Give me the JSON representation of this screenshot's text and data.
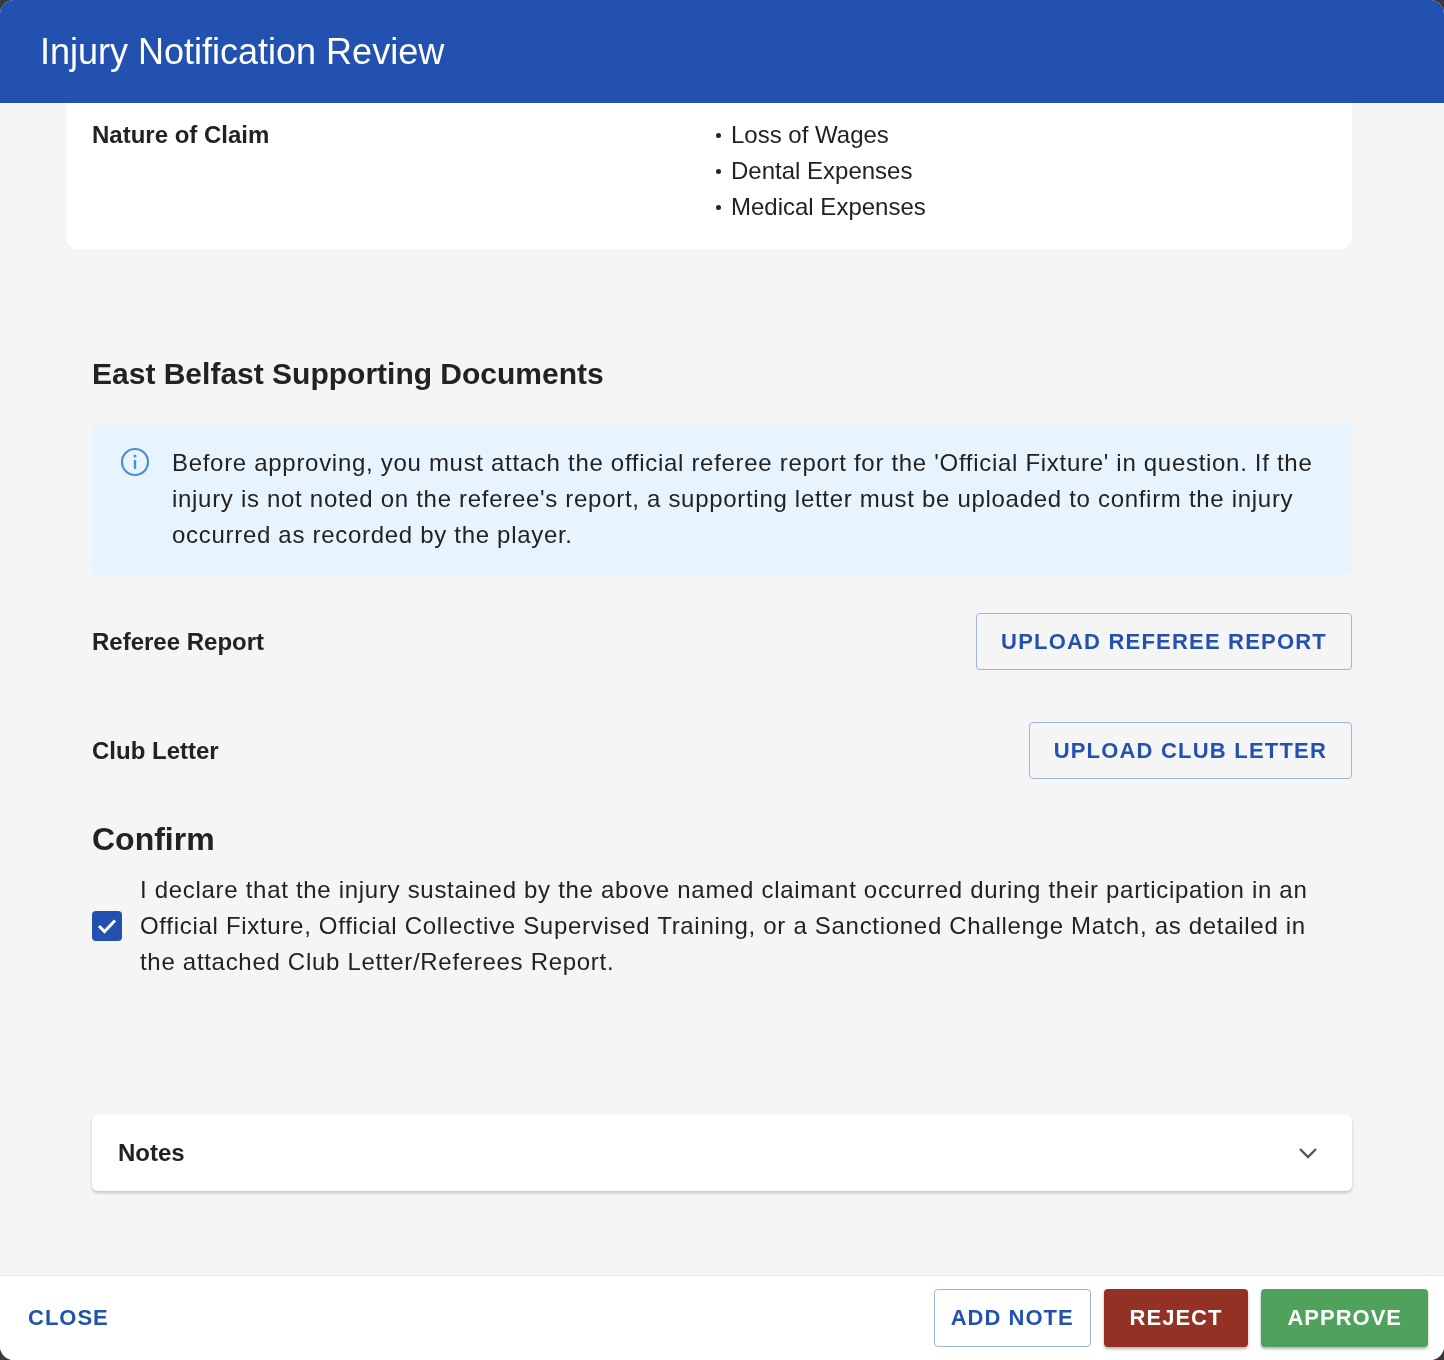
{
  "dialog": {
    "title": "Injury Notification Review"
  },
  "claim": {
    "label": "Nature of Claim",
    "items": [
      "Loss of Wages",
      "Dental Expenses",
      "Medical Expenses"
    ]
  },
  "documents": {
    "heading": "East Belfast Supporting Documents",
    "info": "Before approving, you must attach the official referee report for the 'Official Fixture' in question. If the injury is not noted on the referee's report, a supporting letter must be uploaded to confirm the injury occurred as recorded by the player.",
    "uploads": [
      {
        "label": "Referee Report",
        "button": "UPLOAD REFEREE REPORT"
      },
      {
        "label": "Club Letter",
        "button": "UPLOAD CLUB LETTER"
      }
    ]
  },
  "confirm": {
    "heading": "Confirm",
    "checked": true,
    "text": "I declare that the injury sustained by the above named claimant occurred during their participation in an Official Fixture, Official Collective Supervised Training, or a Sanctioned Challenge Match, as detailed in the attached Club Letter/Referees Report."
  },
  "notes": {
    "title": "Notes",
    "expanded": false
  },
  "footer": {
    "close": "CLOSE",
    "buttons": [
      {
        "label": "ADD NOTE",
        "kind": "outlined"
      },
      {
        "label": "REJECT",
        "kind": "danger"
      },
      {
        "label": "APPROVE",
        "kind": "success"
      }
    ]
  }
}
